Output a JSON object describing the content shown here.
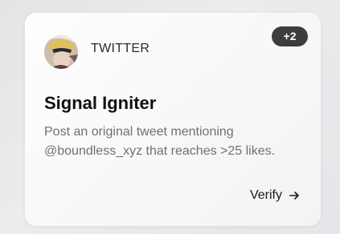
{
  "card": {
    "badge": "+2",
    "platform": "TWITTER",
    "title": "Signal Igniter",
    "description": "Post an original tweet mentioning @boundless_xyz that reaches >25 likes.",
    "verify_label": "Verify"
  },
  "icons": {
    "avatar": "avatar",
    "verify": "arrow-right-icon"
  },
  "colors": {
    "badge_bg": "#3d3d3f",
    "title": "#111111",
    "description": "#707070"
  }
}
